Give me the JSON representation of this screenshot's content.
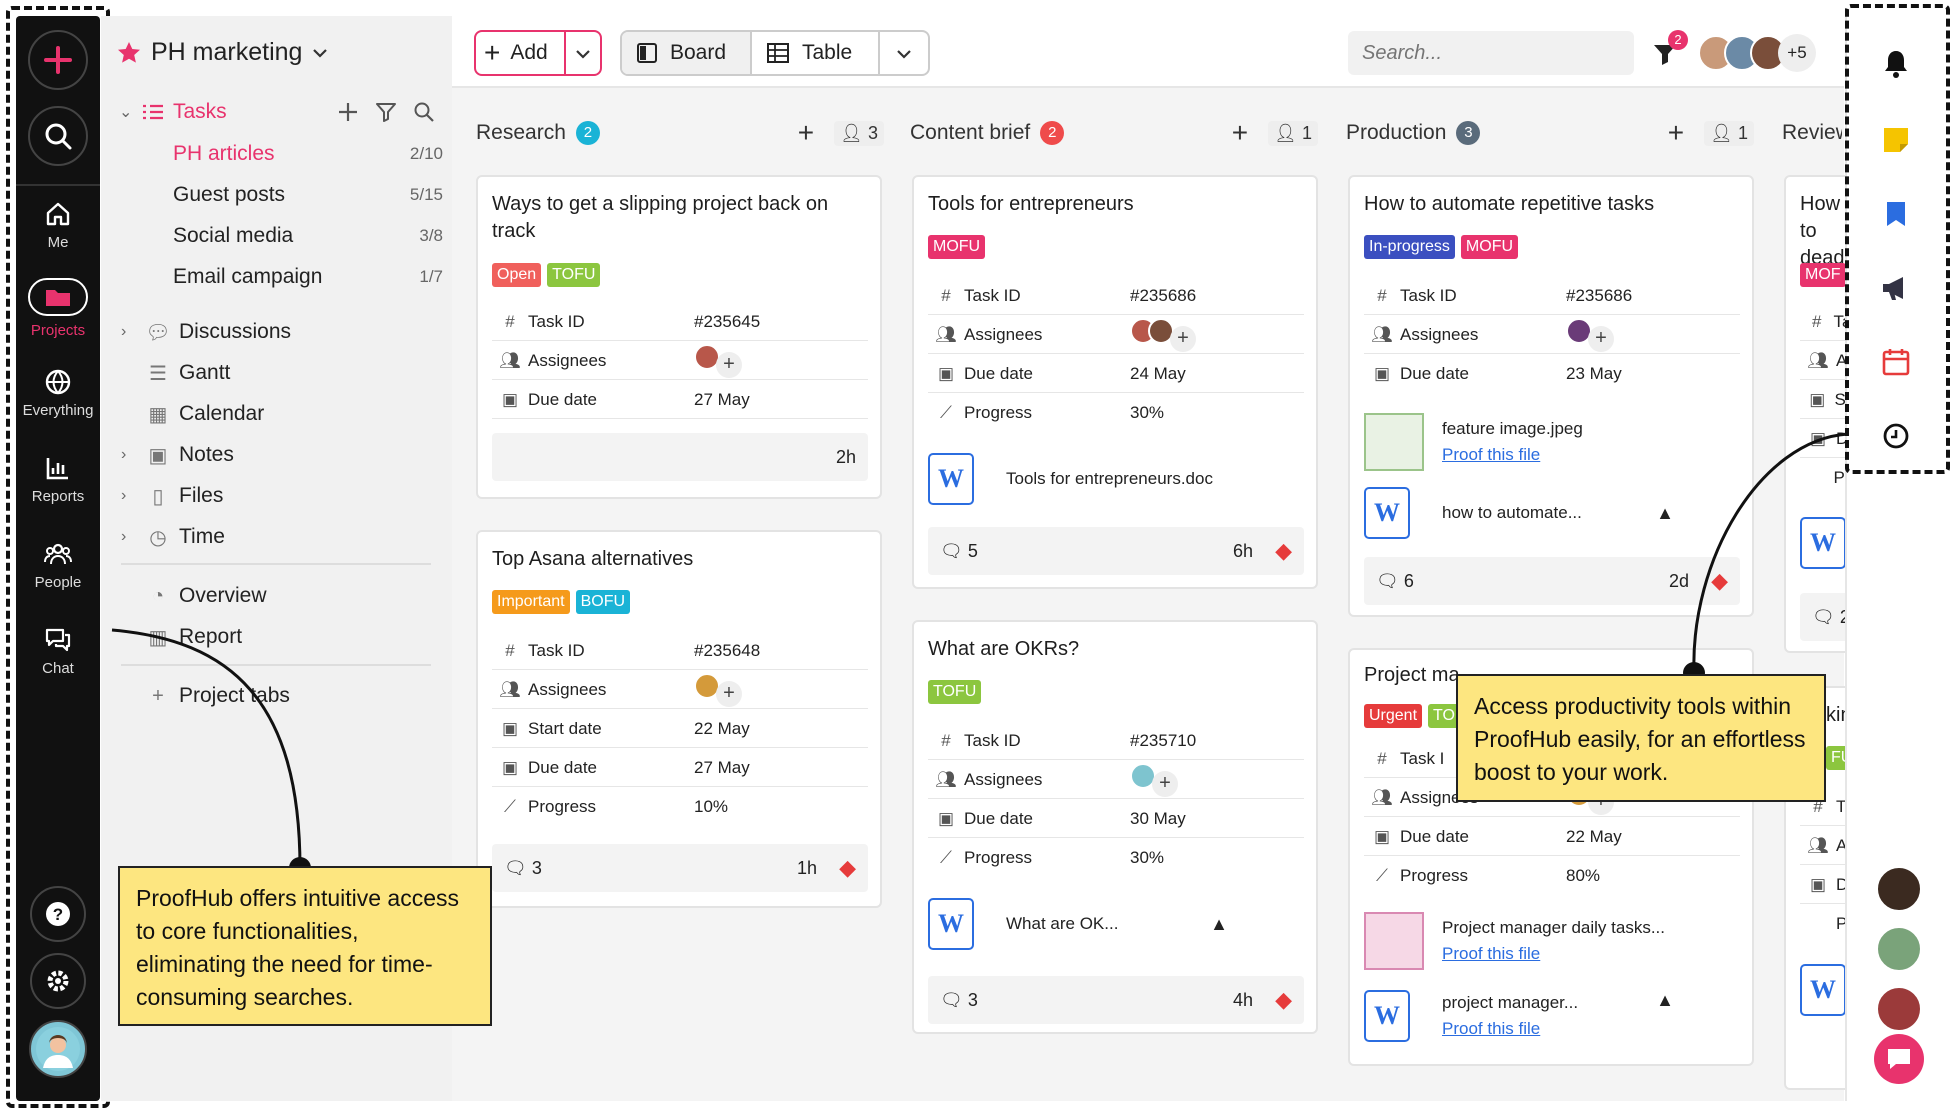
{
  "rail": {
    "me": "Me",
    "projects": "Projects",
    "everything": "Everything",
    "reports": "Reports",
    "people": "People",
    "chat": "Chat"
  },
  "project": {
    "name": "PH marketing",
    "tasks_label": "Tasks",
    "lists": [
      {
        "label": "PH articles",
        "count": "2/10"
      },
      {
        "label": "Guest posts",
        "count": "5/15"
      },
      {
        "label": "Social media",
        "count": "3/8"
      },
      {
        "label": "Email campaign",
        "count": "1/7"
      }
    ],
    "nav": [
      "Discussions",
      "Gantt",
      "Calendar",
      "Notes",
      "Files",
      "Time"
    ],
    "nav2": [
      "Overview",
      "Report"
    ],
    "project_tabs": "Project tabs"
  },
  "toolbar": {
    "add": "Add",
    "board": "Board",
    "table": "Table",
    "search_placeholder": "Search...",
    "notif_count": "2",
    "more_members": "+5"
  },
  "columns": [
    {
      "title": "Research",
      "count": "2",
      "members": "3",
      "color": "#1ab3d6"
    },
    {
      "title": "Content brief",
      "count": "2",
      "members": "1",
      "color": "#ef4b4b"
    },
    {
      "title": "Production",
      "count": "3",
      "members": "1",
      "color": "#5a6b7b"
    },
    {
      "title": "Review",
      "count": "",
      "members": "",
      "color": "#f3c400"
    }
  ],
  "fields": {
    "task_id": "Task ID",
    "assignees": "Assignees",
    "due_date": "Due date",
    "start_date": "Start date",
    "progress": "Progress"
  },
  "cards": {
    "c1": {
      "title": "Ways to get a slipping project back on track",
      "tags": [
        "Open",
        "TOFU"
      ],
      "id": "#235645",
      "due": "27 May",
      "time": "2h"
    },
    "c2": {
      "title": "Top Asana alternatives",
      "tags": [
        "Important",
        "BOFU"
      ],
      "id": "#235648",
      "start": "22 May",
      "due": "27 May",
      "progress": "10%",
      "comments": "3",
      "time": "1h"
    },
    "c3": {
      "title": "Tools for entrepreneurs",
      "tags": [
        "MOFU"
      ],
      "id": "#235686",
      "due": "24 May",
      "progress": "30%",
      "file": "Tools for entrepreneurs.doc",
      "comments": "5",
      "time": "6h"
    },
    "c4": {
      "title": "What are OKRs?",
      "tags": [
        "TOFU"
      ],
      "id": "#235710",
      "due": "30 May",
      "progress": "30%",
      "file": "What are OK...",
      "comments": "3",
      "time": "4h"
    },
    "c5": {
      "title": "How to automate repetitive tasks",
      "tags": [
        "In-progress",
        "MOFU"
      ],
      "id": "#235686",
      "due": "23 May",
      "file1": "feature image.jpeg",
      "proof": "Proof this file",
      "file2": "how to automate...",
      "comments": "6",
      "time": "2d"
    },
    "c6": {
      "title": "Project ma",
      "tags": [
        "Urgent",
        "TO"
      ],
      "id_label": "Task I",
      "due": "22 May",
      "progress": "80%",
      "file1": "Project manager daily tasks...",
      "proof": "Proof this file",
      "file2": "project manager...",
      "proof2": "Proof this file"
    },
    "c7": {
      "title": "How to deadlin",
      "tag": "MOF",
      "f1": "Tas",
      "f2": "As",
      "f3": "Sta",
      "f4": "Du",
      "f5": "Pro",
      "comments": "2"
    },
    "c8": {
      "title": "king",
      "tag": "FU",
      "f1": "Ta",
      "f2": "As",
      "f3": "Du",
      "f4": "Pr"
    }
  },
  "callouts": {
    "left": "ProofHub offers intuitive access to core functionalities, eliminating the need for time-consuming searches.",
    "right": "Access productivity tools within ProofHub easily, for an effortless boost to your work."
  },
  "colors": {
    "accent": "#e8336d",
    "blue": "#2b6de0",
    "callout": "#fde680"
  }
}
